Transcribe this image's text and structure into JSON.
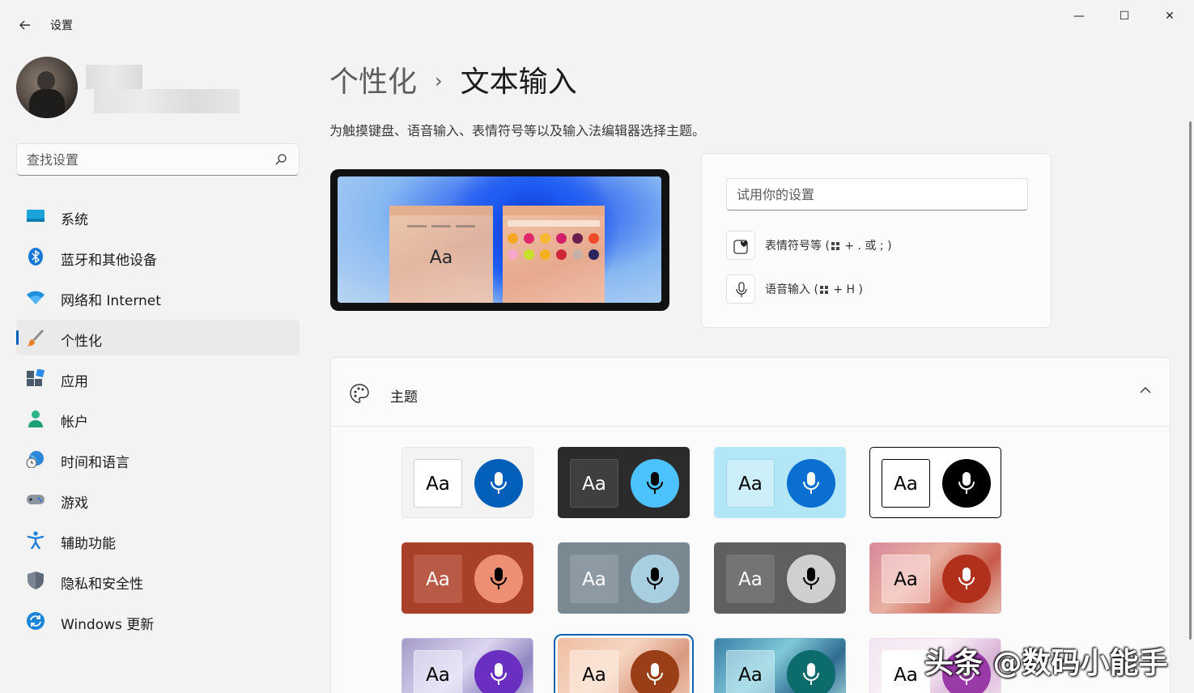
{
  "window": {
    "title": "设置",
    "back_icon": "arrow-left-icon",
    "controls": {
      "minimize": "—",
      "maximize": "☐",
      "close": "✕"
    }
  },
  "search": {
    "placeholder": "查找设置"
  },
  "nav": [
    {
      "label": "系统",
      "icon": "monitor-icon",
      "active": false
    },
    {
      "label": "蓝牙和其他设备",
      "icon": "bluetooth-icon",
      "active": false
    },
    {
      "label": "网络和 Internet",
      "icon": "wifi-icon",
      "active": false
    },
    {
      "label": "个性化",
      "icon": "paintbrush-icon",
      "active": true
    },
    {
      "label": "应用",
      "icon": "apps-icon",
      "active": false
    },
    {
      "label": "帐户",
      "icon": "account-icon",
      "active": false
    },
    {
      "label": "时间和语言",
      "icon": "globe-clock-icon",
      "active": false
    },
    {
      "label": "游戏",
      "icon": "gamepad-icon",
      "active": false
    },
    {
      "label": "辅助功能",
      "icon": "accessibility-icon",
      "active": false
    },
    {
      "label": "隐私和安全性",
      "icon": "shield-icon",
      "active": false
    },
    {
      "label": "Windows 更新",
      "icon": "update-icon",
      "active": false
    }
  ],
  "breadcrumb": {
    "parent": "个性化",
    "separator": "›",
    "current": "文本输入"
  },
  "description": "为触摸键盘、语音输入、表情符号等以及输入法编辑器选择主题。",
  "preview": {
    "sample_text": "Aa"
  },
  "try_panel": {
    "placeholder": "试用你的设置",
    "emoji_prefix": "表情符号等 (",
    "emoji_suffix": " + . 或 ; )",
    "voice_prefix": "语音输入 (",
    "voice_suffix": " + H )"
  },
  "theme": {
    "label": "主题",
    "tiles": [
      {
        "sample": "Aa",
        "bg": "#f3f3f3",
        "aa_bg": "#ffffff",
        "aa_fg": "#000000",
        "aa_border": "#cfcfcf",
        "mic_bg": "#005fb8",
        "mic_fg": "#ffffff",
        "border": "#e6e6e6"
      },
      {
        "sample": "Aa",
        "bg": "#2b2b2b",
        "aa_bg": "#3f3f3f",
        "aa_fg": "#ffffff",
        "aa_border": "#555555",
        "mic_bg": "#4cc2ff",
        "mic_fg": "#000000",
        "border": "#2b2b2b"
      },
      {
        "sample": "Aa",
        "bg": "#b3e6f7",
        "aa_bg": "#cdeffa",
        "aa_fg": "#000000",
        "aa_border": "#9fd7ea",
        "mic_bg": "#0a6fd1",
        "mic_fg": "#ffffff",
        "border": "#b3e6f7"
      },
      {
        "sample": "Aa",
        "bg": "#ffffff",
        "aa_bg": "#ffffff",
        "aa_fg": "#000000",
        "aa_border": "#000000",
        "mic_bg": "#000000",
        "mic_fg": "#ffffff",
        "border": "#000000"
      },
      {
        "sample": "Aa",
        "bg": "#a8402a",
        "aa_bg": "#b85a45",
        "aa_fg": "#ffffff",
        "aa_border": "#b85a45",
        "mic_bg": "#ec8f72",
        "mic_fg": "#000000",
        "border": "#a8402a"
      },
      {
        "sample": "Aa",
        "bg": "#7a8892",
        "aa_bg": "#8d9aa3",
        "aa_fg": "#ffffff",
        "aa_border": "#8d9aa3",
        "mic_bg": "#a8cfe0",
        "mic_fg": "#000000",
        "border": "#7a8892"
      },
      {
        "sample": "Aa",
        "bg": "#5f5f5f",
        "aa_bg": "#747474",
        "aa_fg": "#ffffff",
        "aa_border": "#747474",
        "mic_bg": "#cfcfcf",
        "mic_fg": "#000000",
        "border": "#5f5f5f"
      },
      {
        "sample": "Aa",
        "bg": "linear-gradient(135deg,#d88a9a,#e8b0a0 40%,#c85a4a 70%,#e6c0b0)",
        "aa_bg": "rgba(255,230,230,0.55)",
        "aa_fg": "#000000",
        "aa_border": "rgba(255,230,230,0.55)",
        "mic_bg": "#b0301c",
        "mic_fg": "#ffffff",
        "border": "#e0a0a0"
      },
      {
        "sample": "Aa",
        "bg": "linear-gradient(135deg,#a49cc9,#dcd6f0 45%,#8e84bf 75%,#d4cee8)",
        "aa_bg": "rgba(240,236,250,0.6)",
        "aa_fg": "#000000",
        "aa_border": "rgba(240,236,250,0.6)",
        "mic_bg": "#6a2fc1",
        "mic_fg": "#ffffff",
        "border": "#c4bce0"
      },
      {
        "sample": "Aa",
        "bg": "linear-gradient(135deg,#f0bfa4,#f6d6c2 40%,#d99a80 70%,#f2c9b4)",
        "aa_bg": "rgba(255,240,230,0.55)",
        "aa_fg": "#000000",
        "aa_border": "rgba(255,240,230,0.55)",
        "mic_bg": "#9a3e17",
        "mic_fg": "#ffffff",
        "border": "#f0c0a8",
        "selected": true
      },
      {
        "sample": "Aa",
        "bg": "linear-gradient(135deg,#3a7fa8,#7fc8d8 40%,#2f6b8f 70%,#a6d8e0)",
        "aa_bg": "rgba(210,240,245,0.55)",
        "aa_fg": "#000000",
        "aa_border": "rgba(210,240,245,0.55)",
        "mic_bg": "#0c6b6b",
        "mic_fg": "#ffffff",
        "border": "#6fb0c8"
      },
      {
        "sample": "Aa",
        "bg": "linear-gradient(135deg,#f2e6f2,#fbf0f6 40%,#d9b6d8 70%,#f3e1ee)",
        "aa_bg": "#ffffff",
        "aa_fg": "#000000",
        "aa_border": "#ffffff",
        "mic_bg": "#9a3aa8",
        "mic_fg": "#ffffff",
        "border": "#eadcea"
      }
    ]
  },
  "watermark": "头条 @数码小能手"
}
